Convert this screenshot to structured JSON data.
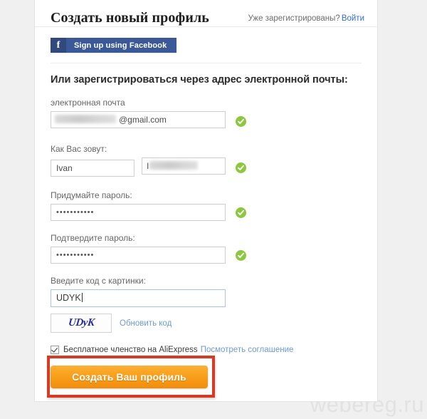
{
  "header": {
    "title": "Создать новый профиль",
    "already_registered": "Уже зарегистрированы?",
    "login_link": "Войти"
  },
  "social": {
    "facebook_icon": "facebook-f-icon",
    "facebook_label": "Sign up using Facebook"
  },
  "section": {
    "email_heading": "Или зарегистрироваться через адрес электронной почты:"
  },
  "fields": {
    "email": {
      "label": "электронная почта",
      "value_visible": "@gmail.com",
      "masked": true,
      "valid_icon": "check-circle-icon"
    },
    "name": {
      "label": "Как Вас зовут:",
      "first_value": "Ivan",
      "last_value_visible": "I",
      "last_masked": true,
      "valid_icon": "check-circle-icon"
    },
    "password": {
      "label": "Придумайте пароль:",
      "value": "•••••••••••",
      "valid_icon": "check-circle-icon"
    },
    "password_confirm": {
      "label": "Подтвердите пароль:",
      "value": "•••••••••••",
      "valid_icon": "check-circle-icon"
    },
    "captcha": {
      "label": "Введите код с картинки:",
      "value": "UDYK",
      "image_text": "UDyK",
      "refresh_label": "Обновить код"
    }
  },
  "agreement": {
    "checked": true,
    "text": "Бесплатное членство на AliExpress",
    "link": "Посмотреть соглашение"
  },
  "submit": {
    "label": "Создать Ваш профиль"
  },
  "watermark": {
    "text": "webereg.ru"
  },
  "colors": {
    "facebook_blue": "#3b5998",
    "link_blue": "#6e9ad6",
    "accent_orange": "#f9a01b",
    "valid_green": "#8dc63f",
    "annotation_red": "#d83b23"
  }
}
